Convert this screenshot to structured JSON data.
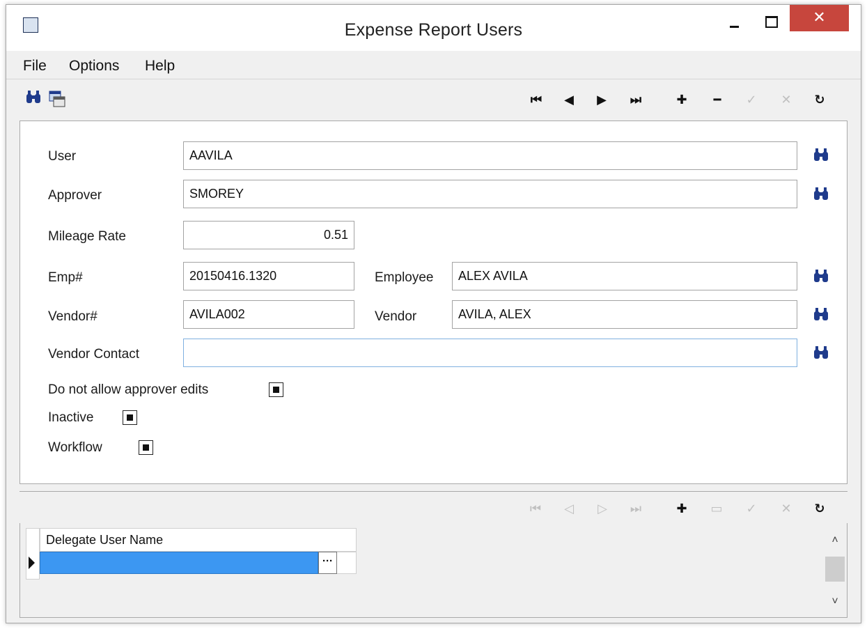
{
  "window": {
    "title": "Expense Report Users",
    "close_glyph": "✕"
  },
  "menu": {
    "items": [
      "File",
      "Options",
      "Help"
    ]
  },
  "toolbar": {
    "left_icons": [
      "binoculars-icon",
      "window-list-icon"
    ],
    "nav_glyphs": {
      "first": "⏮",
      "prev": "◀",
      "next": "▶",
      "last": "⏭",
      "add": "✚",
      "remove": "━",
      "accept": "✓",
      "cancel": "✕",
      "refresh": "↻"
    }
  },
  "form": {
    "user_label": "User",
    "user_value": "AAVILA",
    "approver_label": "Approver",
    "approver_value": "SMOREY",
    "mileage_rate_label": "Mileage Rate",
    "mileage_rate_value": "0.51",
    "emp_no_label": "Emp#",
    "emp_no_value": "20150416.1320",
    "employee_label": "Employee",
    "employee_value": "ALEX AVILA",
    "vendor_no_label": "Vendor#",
    "vendor_no_value": "AVILA002",
    "vendor_label": "Vendor",
    "vendor_value": "AVILA, ALEX",
    "vendor_contact_label": "Vendor Contact",
    "vendor_contact_value": "",
    "no_approver_edits_label": "Do not allow approver edits",
    "inactive_label": "Inactive",
    "workflow_label": "Workflow"
  },
  "grid_toolbar": {
    "nav_glyphs": {
      "first": "⏮",
      "prev": "◁",
      "next": "▷",
      "last": "⏭",
      "add": "✚",
      "remove": "▭",
      "accept": "✓",
      "cancel": "✕",
      "refresh": "↻"
    }
  },
  "grid": {
    "columns": [
      "Delegate User Name"
    ],
    "ellipsis": "···",
    "scroll_up": "˄",
    "scroll_down": "˅"
  },
  "colors": {
    "close_button": "#c7463d",
    "selected_cell": "#3c97f2",
    "icon_blue": "#1f3b8c"
  }
}
